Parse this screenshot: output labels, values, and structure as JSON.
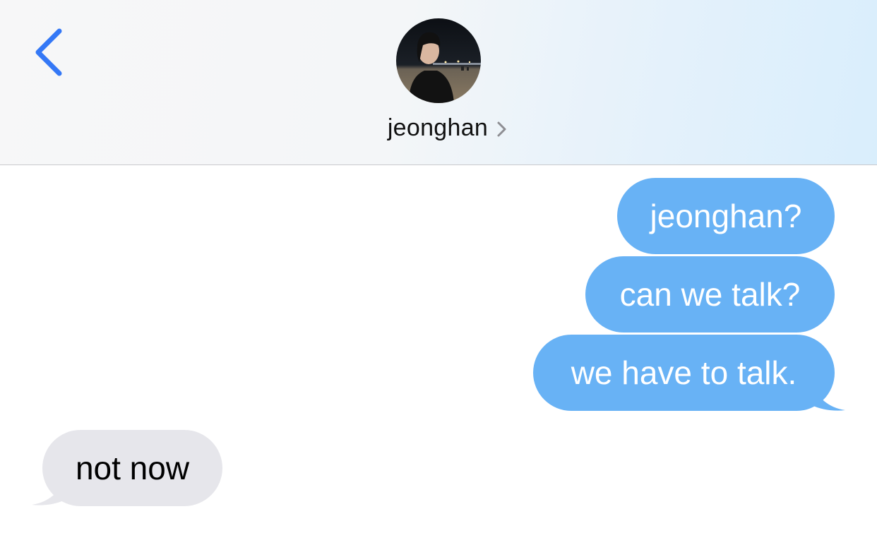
{
  "header": {
    "contact_name": "jeonghan",
    "back_icon": "chevron-left-icon",
    "disclosure_icon": "chevron-right-icon",
    "accent_color": "#3478f6"
  },
  "messages": [
    {
      "direction": "sent",
      "text": "jeonghan?"
    },
    {
      "direction": "sent",
      "text": "can we talk?"
    },
    {
      "direction": "sent",
      "text": "we have to talk."
    },
    {
      "direction": "received",
      "text": "not now"
    }
  ],
  "colors": {
    "sent_bubble": "#68b2f5",
    "received_bubble": "#e6e6eb"
  }
}
